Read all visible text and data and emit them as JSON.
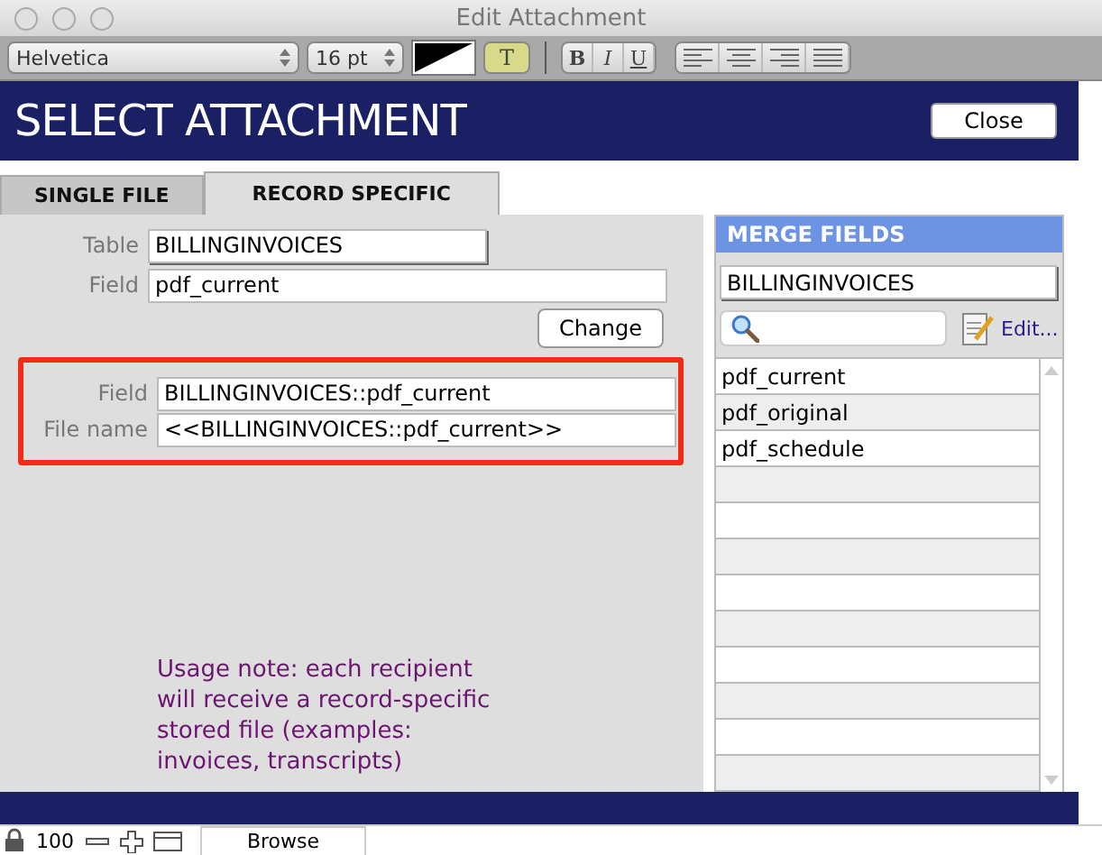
{
  "window": {
    "title": "Edit Attachment"
  },
  "toolbar": {
    "font": "Helvetica",
    "size": "16 pt",
    "highlight": "T",
    "styles": [
      "B",
      "I",
      "U"
    ]
  },
  "header": {
    "title": "SELECT ATTACHMENT",
    "close_button": "Close"
  },
  "tabs": [
    {
      "label": "SINGLE FILE",
      "selected": false
    },
    {
      "label": "RECORD SPECIFIC",
      "selected": true
    }
  ],
  "form": {
    "table_label": "Table",
    "table_value": "BILLINGINVOICES",
    "field_label": "Field",
    "field_value": "pdf_current",
    "change_button": "Change"
  },
  "highlighted": {
    "rows": [
      {
        "label": "Field",
        "value": "BILLINGINVOICES::pdf_current"
      },
      {
        "label": "File name",
        "value": "<<BILLINGINVOICES::pdf_current>>"
      }
    ]
  },
  "note": "Usage note: each recipient will receive a record-specific stored file (examples: invoices, transcripts)",
  "merge_fields": {
    "title": "MERGE FIELDS",
    "table": "BILLINGINVOICES",
    "edit": "Edit...",
    "items": [
      "pdf_current",
      "pdf_original",
      "pdf_schedule"
    ]
  },
  "status_bar": {
    "zoom": "100",
    "mode": "Browse"
  }
}
